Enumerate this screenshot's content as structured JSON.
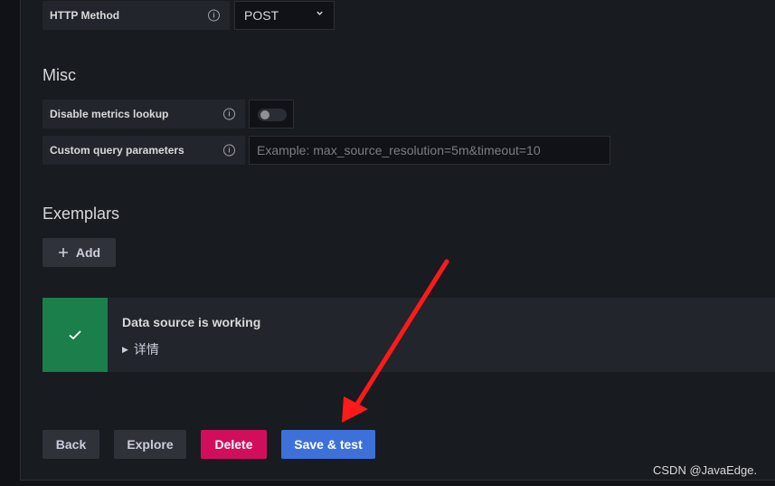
{
  "http": {
    "method_label": "HTTP Method",
    "method_value": "POST"
  },
  "misc": {
    "heading": "Misc",
    "disable_metrics_label": "Disable metrics lookup",
    "disable_metrics_enabled": false,
    "custom_query_label": "Custom query parameters",
    "custom_query_placeholder": "Example: max_source_resolution=5m&timeout=10",
    "custom_query_value": ""
  },
  "exemplars": {
    "heading": "Exemplars",
    "add_label": "Add"
  },
  "alert": {
    "title": "Data source is working",
    "details_label": "详情"
  },
  "buttons": {
    "back": "Back",
    "explore": "Explore",
    "delete": "Delete",
    "save_test": "Save & test"
  },
  "watermark": "CSDN @JavaEdge.",
  "colors": {
    "success": "#1a7f4b",
    "danger": "#d10e5c",
    "primary": "#3d71d9",
    "annotation_arrow": "#ff0000"
  }
}
